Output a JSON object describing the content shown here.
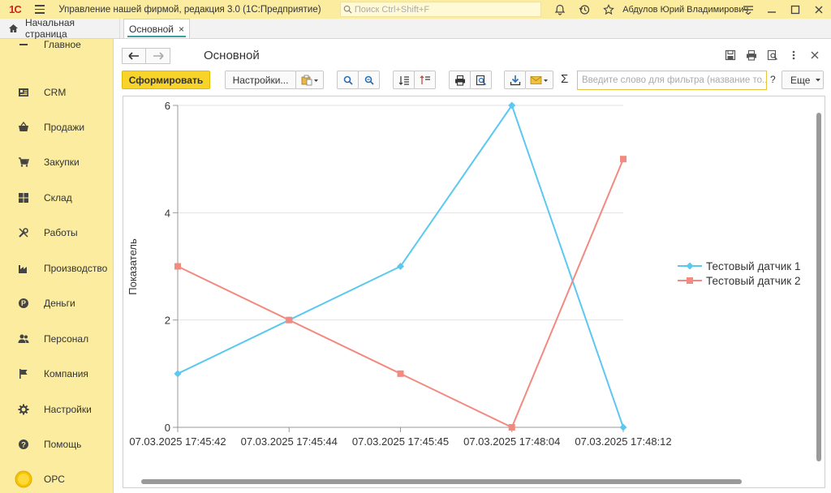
{
  "titlebar": {
    "logo": "1С",
    "app_title": "Управление нашей фирмой, редакция 3.0  (1С:Предприятие)",
    "search_placeholder": "Поиск Ctrl+Shift+F",
    "user_name": "Абдулов Юрий Владимирович"
  },
  "tabs": {
    "home_label": "Начальная страница",
    "active_label": "Основной",
    "close_symbol": "×"
  },
  "sidebar": {
    "items": [
      {
        "label": "Главное",
        "icon": "home-icon"
      },
      {
        "label": "CRM",
        "icon": "crm-icon"
      },
      {
        "label": "Продажи",
        "icon": "basket-icon"
      },
      {
        "label": "Закупки",
        "icon": "cart-icon"
      },
      {
        "label": "Склад",
        "icon": "warehouse-icon"
      },
      {
        "label": "Работы",
        "icon": "tools-icon"
      },
      {
        "label": "Производство",
        "icon": "factory-icon"
      },
      {
        "label": "Деньги",
        "icon": "money-icon"
      },
      {
        "label": "Персонал",
        "icon": "people-icon"
      },
      {
        "label": "Компания",
        "icon": "flag-icon"
      },
      {
        "label": "Настройки",
        "icon": "gear-icon"
      },
      {
        "label": "Помощь",
        "icon": "help-icon"
      },
      {
        "label": "ОРС",
        "icon": "orc-circle-icon"
      }
    ]
  },
  "header": {
    "page_title": "Основной"
  },
  "toolbar": {
    "generate_label": "Сформировать",
    "settings_label": "Настройки...",
    "sigma": "Σ",
    "filter_placeholder": "Введите слово для фильтра (название то...",
    "help_label": "?",
    "more_label": "Еще"
  },
  "colors": {
    "series1": "#5bc8f0",
    "series2": "#f28a80",
    "accent_yellow": "#f8d42a",
    "sidebar_bg": "#fbeca0"
  },
  "chart_data": {
    "type": "line",
    "ylabel": "Показатель",
    "xlabel": "",
    "ylim": [
      0,
      6
    ],
    "yticks": [
      "0",
      "2",
      "4",
      "6"
    ],
    "grid": true,
    "legend_position": "right",
    "categories": [
      "07.03.2025 17:45:42",
      "07.03.2025 17:45:44",
      "07.03.2025 17:45:45",
      "07.03.2025 17:48:04",
      "07.03.2025 17:48:12"
    ],
    "series": [
      {
        "name": "Тестовый датчик 1",
        "marker": "diamond",
        "values": [
          1,
          2,
          3,
          6,
          0
        ]
      },
      {
        "name": "Тестовый датчик 2",
        "marker": "square",
        "values": [
          3,
          2,
          1,
          0,
          5
        ]
      }
    ]
  }
}
